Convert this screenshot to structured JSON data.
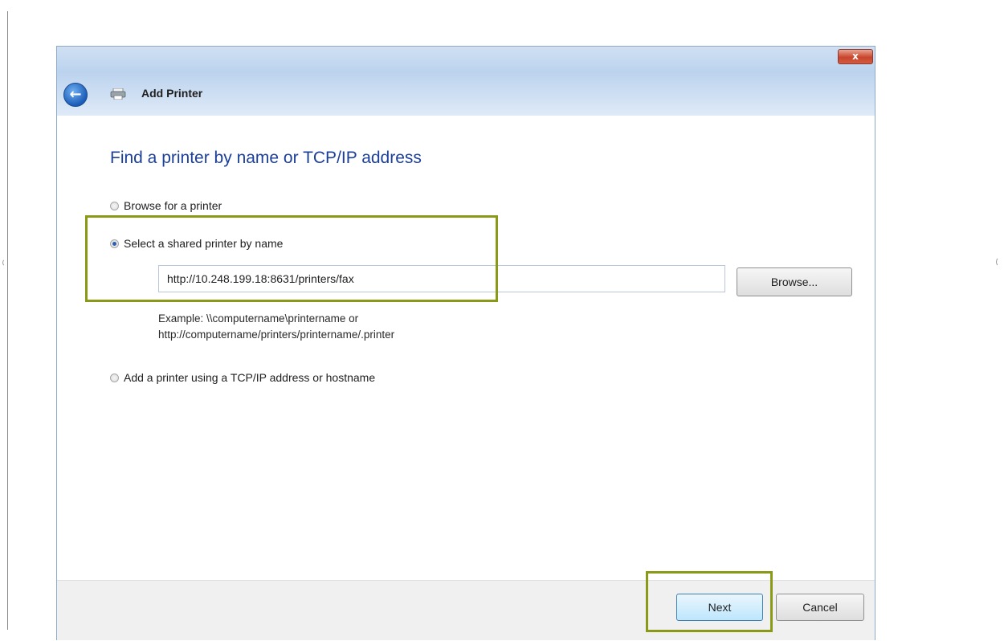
{
  "window": {
    "title": "Add Printer",
    "close_label": "x"
  },
  "main": {
    "heading": "Find a printer by name or TCP/IP address",
    "options": [
      {
        "label": "Browse for a printer",
        "selected": false
      },
      {
        "label": "Select a shared printer by name",
        "selected": true
      },
      {
        "label": "Add a printer using a TCP/IP address or hostname",
        "selected": false
      }
    ],
    "printer_name_value": "http://10.248.199.18:8631/printers/fax",
    "browse_label": "Browse...",
    "example_line1": "Example: \\\\computername\\printername or",
    "example_line2": "http://computername/printers/printername/.printer"
  },
  "footer": {
    "next_label": "Next",
    "cancel_label": "Cancel"
  },
  "annotation": {
    "highlight_color": "#8a9a16"
  },
  "icons": {
    "back": "back-arrow-icon",
    "printer": "printer-icon",
    "close": "close-icon"
  },
  "colors": {
    "heading": "#1c3f9a",
    "titlebar": "#bcd3ee",
    "close_button": "#c8452c",
    "next_button_border": "#3c7fb1"
  }
}
